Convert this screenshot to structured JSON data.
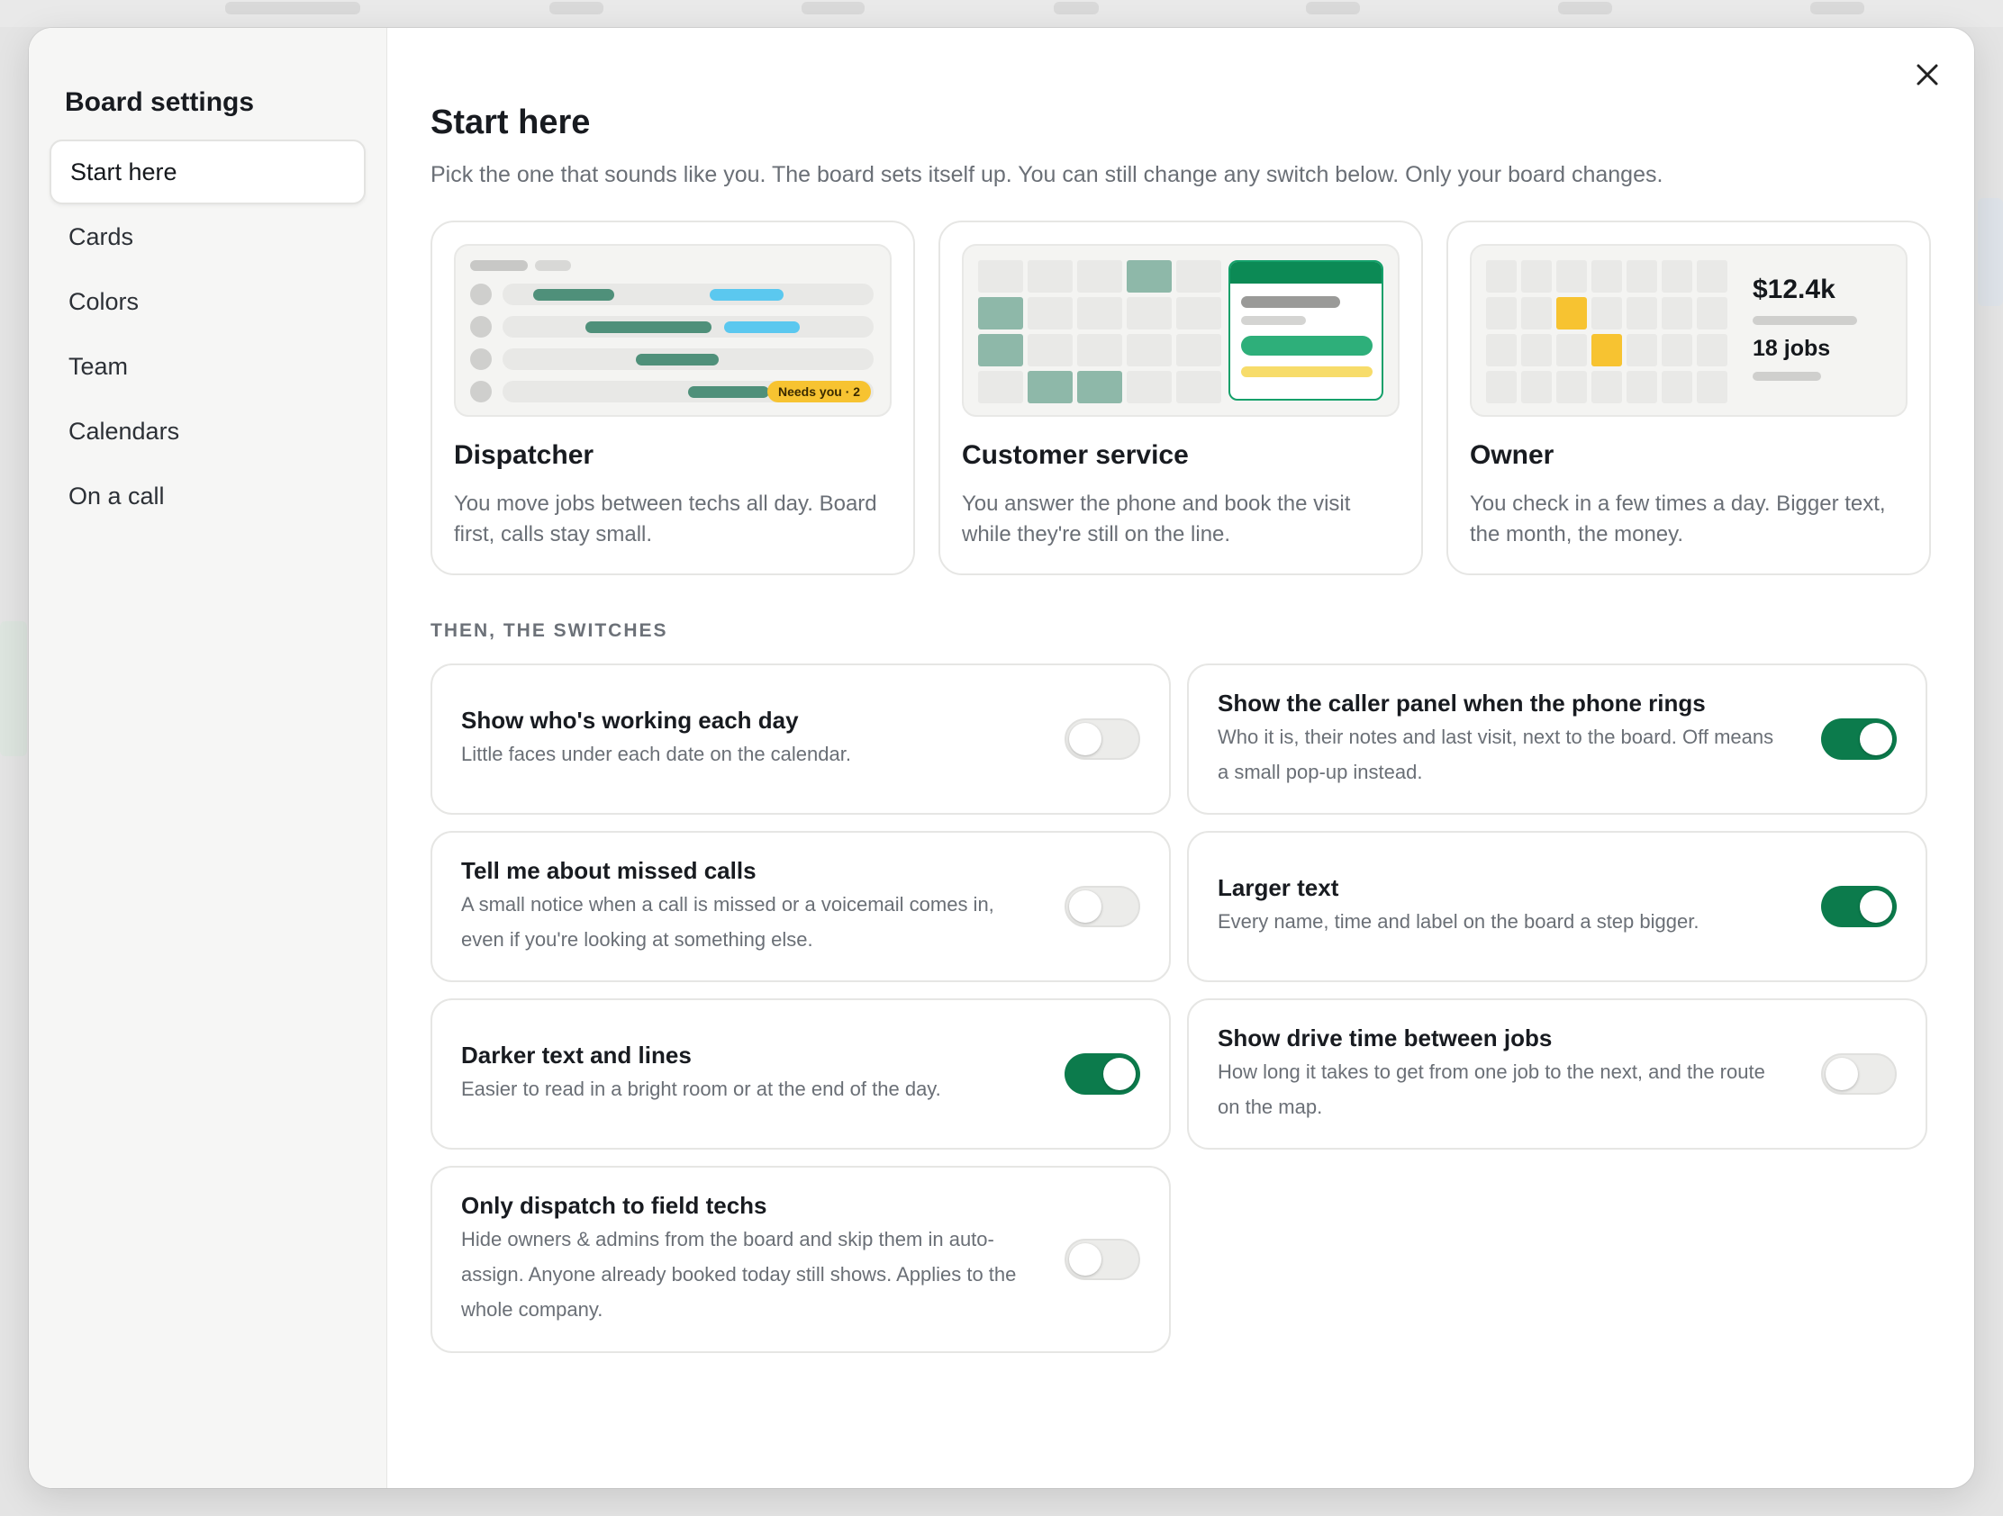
{
  "sidebar": {
    "title": "Board settings",
    "items": [
      {
        "label": "Start here",
        "active": true
      },
      {
        "label": "Cards"
      },
      {
        "label": "Colors"
      },
      {
        "label": "Team"
      },
      {
        "label": "Calendars"
      },
      {
        "label": "On a call"
      }
    ]
  },
  "main": {
    "title": "Start here",
    "subtitle": "Pick the one that sounds like you. The board sets itself up. You can still change any switch below. Only your board changes.",
    "close_icon": "close-icon"
  },
  "personas": [
    {
      "name": "Dispatcher",
      "description": "You move jobs between techs all day. Board first, calls stay small.",
      "preview_badge": "Needs you · 2"
    },
    {
      "name": "Customer service",
      "description": "You answer the phone and book the visit while they're still on the line."
    },
    {
      "name": "Owner",
      "description": "You check in a few times a day. Bigger text, the month, the money.",
      "preview_amount": "$12.4k",
      "preview_jobs": "18 jobs"
    }
  ],
  "switches_label": "THEN, THE SWITCHES",
  "switches": [
    {
      "title": "Show who's working each day",
      "description": "Little faces under each date on the calendar.",
      "on": false
    },
    {
      "title": "Show the caller panel when the phone rings",
      "description": "Who it is, their notes and last visit, next to the board. Off means a small pop-up instead.",
      "on": true
    },
    {
      "title": "Tell me about missed calls",
      "description": "A small notice when a call is missed or a voicemail comes in, even if you're looking at something else.",
      "on": false
    },
    {
      "title": "Larger text",
      "description": "Every name, time and label on the board a step bigger.",
      "on": true
    },
    {
      "title": "Darker text and lines",
      "description": "Easier to read in a bright room or at the end of the day.",
      "on": true
    },
    {
      "title": "Show drive time between jobs",
      "description": "How long it takes to get from one job to the next, and the route on the map.",
      "on": false
    },
    {
      "title": "Only dispatch to field techs",
      "description": "Hide owners & admins from the board and skip them in auto-assign. Anyone already booked today still shows. Applies to the whole company.",
      "on": false
    }
  ],
  "colors": {
    "accent": "#0c7b4c",
    "teal": "#5b9a84",
    "sky": "#5bc8ef",
    "yellow": "#f7c331"
  }
}
